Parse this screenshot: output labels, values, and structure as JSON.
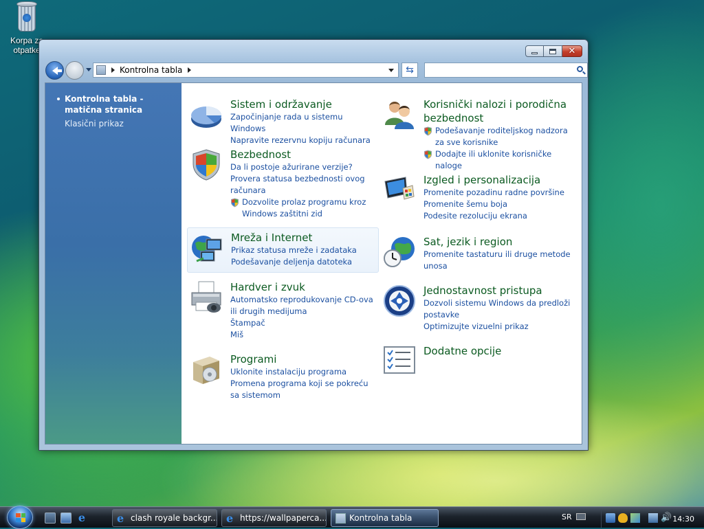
{
  "desktop": {
    "recycle_bin_label": "Korpa za otpatke"
  },
  "window": {
    "title": "Kontrolna tabla",
    "address": {
      "icon": "control-panel-icon",
      "crumb": "Kontrolna tabla"
    },
    "search": {
      "placeholder": ""
    },
    "sidebar": {
      "items": [
        {
          "label": "Kontrolna tabla - matična stranica",
          "active": true
        },
        {
          "label": "Klasični prikaz",
          "active": false
        }
      ]
    },
    "categories": {
      "system": {
        "title": "Sistem i održavanje",
        "icon": "pie-chart-icon",
        "links": [
          "Započinjanje rada u sistemu Windows",
          "Napravite rezervnu kopiju računara"
        ]
      },
      "security": {
        "title": "Bezbednost",
        "icon": "security-shield-icon",
        "links": [
          "Da li postoje ažurirane verzije?",
          "Provera statusa bezbednosti ovog računara",
          "Dozvolite prolaz programu kroz Windows zaštitni zid"
        ]
      },
      "network": {
        "title": "Mreža i Internet",
        "icon": "globe-network-icon",
        "links": [
          "Prikaz statusa mreže i zadataka",
          "Podešavanje deljenja datoteka"
        ]
      },
      "hardware": {
        "title": "Hardver i zvuk",
        "icon": "printer-icon",
        "links": [
          "Automatsko reprodukovanje CD-ova ili drugih medijuma",
          "Štampač",
          "Miš"
        ]
      },
      "programs": {
        "title": "Programi",
        "icon": "programs-box-icon",
        "links": [
          "Uklonite instalaciju programa",
          "Promena programa koji se pokreću sa sistemom"
        ]
      },
      "users": {
        "title": "Korisnički nalozi i porodična bezbednost",
        "icon": "users-icon",
        "links": [
          "Podešavanje roditeljskog nadzora za sve korisnike",
          "Dodajte ili uklonite korisničke naloge"
        ]
      },
      "appearance": {
        "title": "Izgled i personalizacija",
        "icon": "monitor-brush-icon",
        "links": [
          "Promenite pozadinu radne površine",
          "Promenite šemu boja",
          "Podesite rezoluciju ekrana"
        ]
      },
      "clock": {
        "title": "Sat, jezik i region",
        "icon": "globe-clock-icon",
        "links": [
          "Promenite tastaturu ili druge metode unosa"
        ]
      },
      "access": {
        "title": "Jednostavnost pristupa",
        "icon": "ease-of-access-icon",
        "links": [
          "Dozvoli sistemu Windows da predloži postavke",
          "Optimizujte vizuelni prikaz"
        ]
      },
      "additional": {
        "title": "Dodatne opcije",
        "icon": "checklist-icon",
        "links": []
      }
    }
  },
  "taskbar": {
    "buttons": [
      {
        "label": "clash royale backgr...",
        "icon": "ie-icon",
        "active": false
      },
      {
        "label": "https://wallpaperca...",
        "icon": "ie-icon",
        "active": false
      },
      {
        "label": "Kontrolna tabla",
        "icon": "control-panel-icon",
        "active": true
      }
    ],
    "language": "SR",
    "clock": "14:30"
  }
}
